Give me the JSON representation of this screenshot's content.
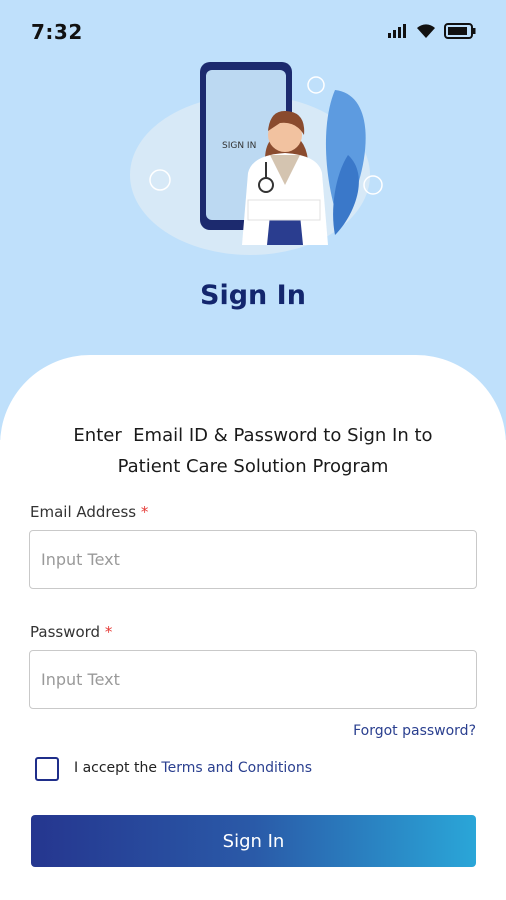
{
  "status_bar": {
    "time": "7:32",
    "icons": [
      "signal-icon",
      "wifi-icon",
      "battery-icon"
    ]
  },
  "header": {
    "title": "Sign In",
    "illustration_text": "SIGN IN"
  },
  "intro": {
    "line1": "Enter  Email ID & Password to Sign In to",
    "line2": "Patient Care Solution Program"
  },
  "form": {
    "email": {
      "label": "Email Address",
      "required_mark": "*",
      "placeholder": "Input Text",
      "value": ""
    },
    "password": {
      "label": "Password",
      "required_mark": "*",
      "placeholder": "Input Text",
      "value": ""
    },
    "forgot_password": "Forgot password?",
    "terms": {
      "prefix": "I accept the",
      "link": "Terms and Conditions",
      "checked": false
    },
    "submit_label": "Sign In"
  },
  "colors": {
    "header_bg": "#bfe0fb",
    "title": "#13266d",
    "link": "#2a3f8f",
    "button_start": "#25368f",
    "button_end": "#2aa6d8",
    "required": "#e53935"
  }
}
